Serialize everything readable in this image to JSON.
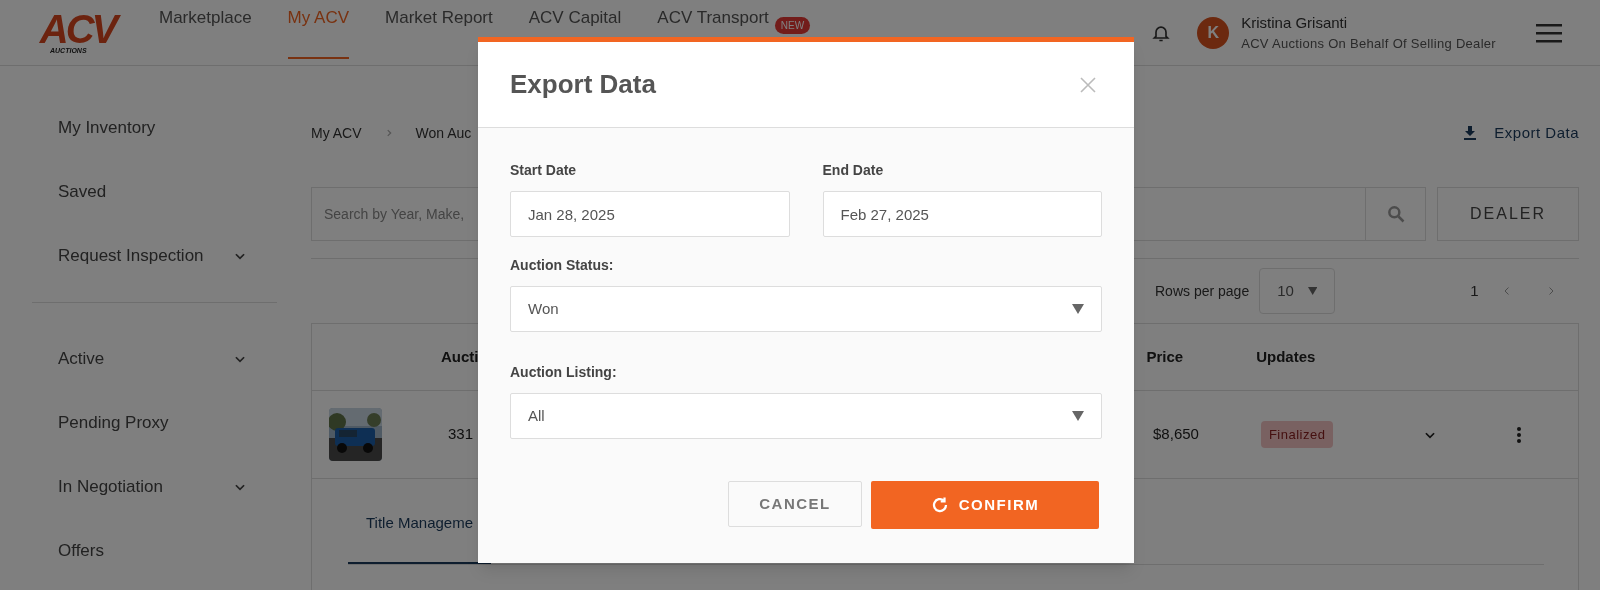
{
  "logo": {
    "text": "ACV",
    "subtext": "AUCTIONS"
  },
  "nav": [
    {
      "label": "Marketplace",
      "selected": false
    },
    {
      "label": "My ACV",
      "selected": true
    },
    {
      "label": "Market Report",
      "selected": false
    },
    {
      "label": "ACV Capital",
      "selected": false
    },
    {
      "label": "ACV Transport",
      "selected": false,
      "badge": "NEW"
    }
  ],
  "user": {
    "initial": "K",
    "name": "Kristina Grisanti",
    "subtitle": "ACV Auctions On Behalf Of Selling Dealer"
  },
  "sidebar": {
    "sections": [
      [
        {
          "label": "My Inventory",
          "expandable": false
        },
        {
          "label": "Saved",
          "expandable": false
        },
        {
          "label": "Request Inspection",
          "expandable": true
        }
      ],
      [
        {
          "label": "Active",
          "expandable": true
        },
        {
          "label": "Pending Proxy",
          "expandable": false
        },
        {
          "label": "In Negotiation",
          "expandable": true
        },
        {
          "label": "Offers",
          "expandable": false
        }
      ]
    ]
  },
  "breadcrumb": [
    "My ACV",
    "Won Auc"
  ],
  "export_link": "Export Data",
  "search": {
    "placeholder": "Search by Year, Make,"
  },
  "filter_button": "DEALER",
  "pagination": {
    "rows_label": "Rows per page",
    "rows_value": "10",
    "page": "1"
  },
  "table": {
    "columns": [
      "Aucti",
      "Price",
      "Updates"
    ],
    "rows": [
      {
        "auction": "331",
        "price": "$8,650",
        "status": "Finalized"
      }
    ]
  },
  "detail_tabs": [
    {
      "label": "Title Manageme",
      "selected": true
    }
  ],
  "dialog": {
    "title": "Export Data",
    "dates": [
      {
        "label": "Start Date",
        "value": "Jan 28, 2025"
      },
      {
        "label": "End Date",
        "value": "Feb 27, 2025"
      }
    ],
    "selects": [
      {
        "label": "Auction Status:",
        "value": "Won"
      },
      {
        "label": "Auction Listing:",
        "value": "All"
      }
    ],
    "buttons": [
      {
        "label": "CANCEL",
        "kind": "secondary"
      },
      {
        "label": "CONFIRM",
        "kind": "primary"
      }
    ]
  }
}
